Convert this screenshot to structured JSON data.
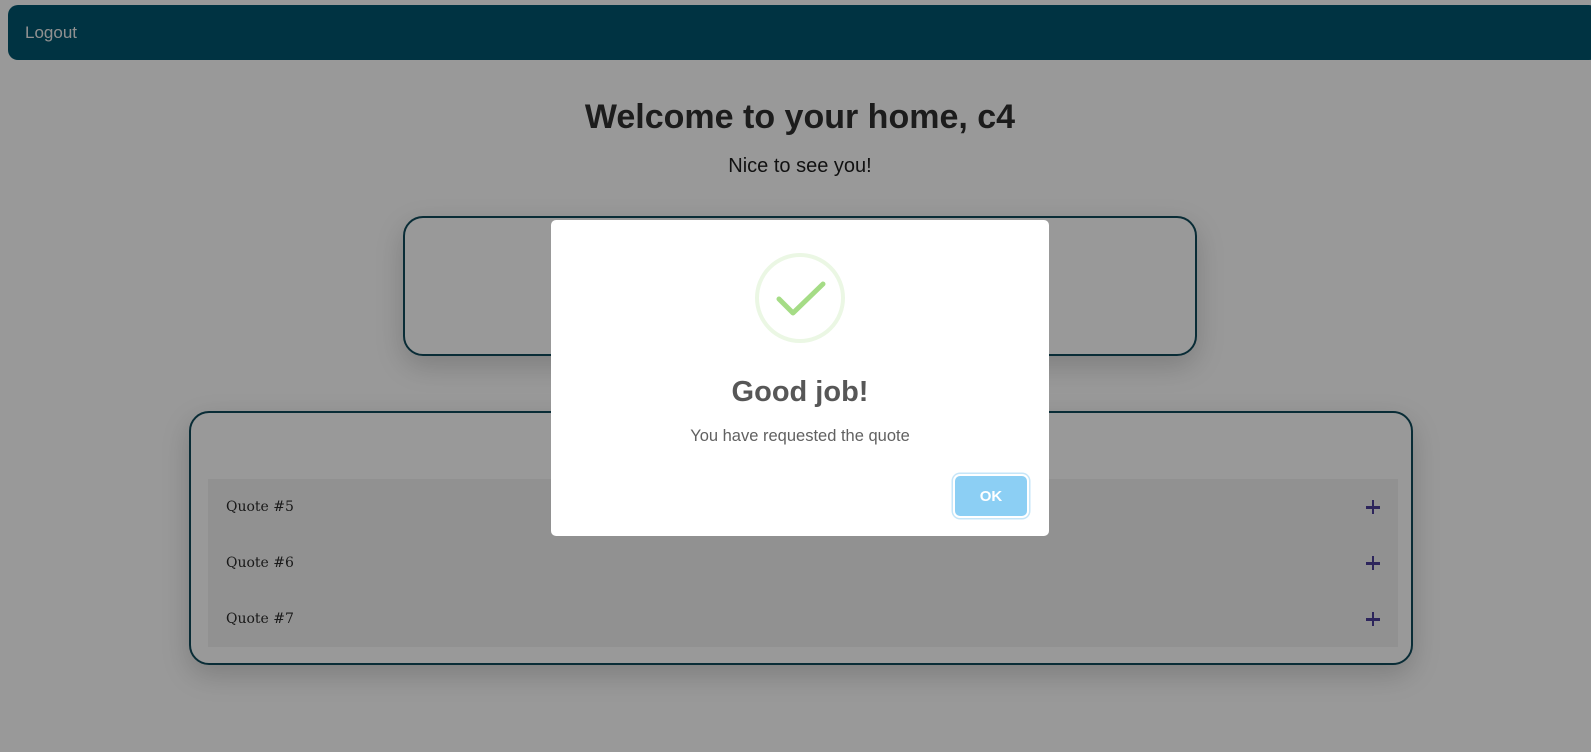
{
  "nav": {
    "logout_label": "Logout"
  },
  "welcome": {
    "title": "Welcome to your home, c4",
    "subtitle": "Nice to see you!"
  },
  "quotes": [
    {
      "title": "Quote #5",
      "icon": "plus-icon"
    },
    {
      "title": "Quote #6",
      "icon": "plus-icon"
    },
    {
      "title": "Quote #7",
      "icon": "plus-icon"
    }
  ],
  "modal": {
    "icon": "success-check-icon",
    "title": "Good job!",
    "text": "You have requested the quote",
    "ok_label": "OK"
  },
  "colors": {
    "navbar": "#00566e",
    "card_border": "#0f4a5b",
    "plus_icon": "#4b3f9a",
    "check": "#a5dc86",
    "ok_button": "#8ccff4"
  }
}
